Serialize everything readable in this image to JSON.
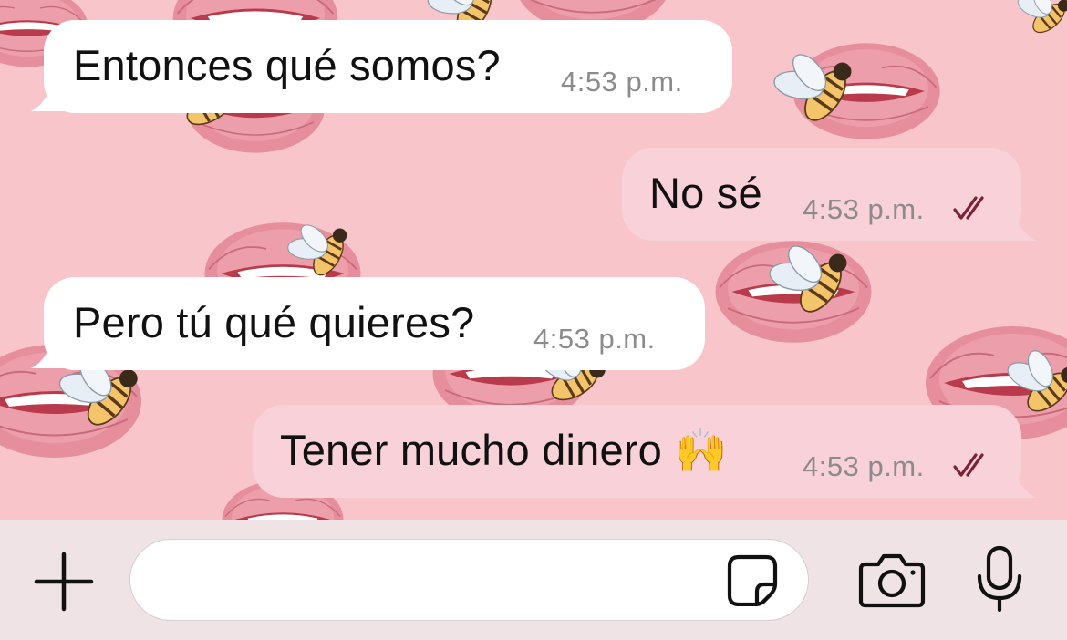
{
  "conversation": {
    "messages": [
      {
        "direction": "incoming",
        "text": "Entonces qué somos?",
        "time": "4:53 p.m."
      },
      {
        "direction": "outgoing",
        "text": "No sé",
        "time": "4:53 p.m.",
        "status": "read"
      },
      {
        "direction": "incoming",
        "text": "Pero tú qué quieres?",
        "time": "4:53 p.m."
      },
      {
        "direction": "outgoing",
        "text": "Tener mucho dinero 🙌",
        "time": "4:53 p.m.",
        "status": "read"
      }
    ]
  },
  "composer": {
    "value": "",
    "placeholder": ""
  },
  "icons": {
    "add": "plus-icon",
    "sticker": "sticker-icon",
    "camera": "camera-icon",
    "mic": "microphone-icon",
    "read_receipt": "double-check-icon"
  },
  "colors": {
    "wallpaper": "#f7c5ca",
    "incoming_bubble": "#ffffff",
    "outgoing_bubble": "#f9d1d8",
    "read_ticks": "#7a2335",
    "timestamp": "#8b8b8b",
    "input_bar": "#f0e3e5"
  }
}
